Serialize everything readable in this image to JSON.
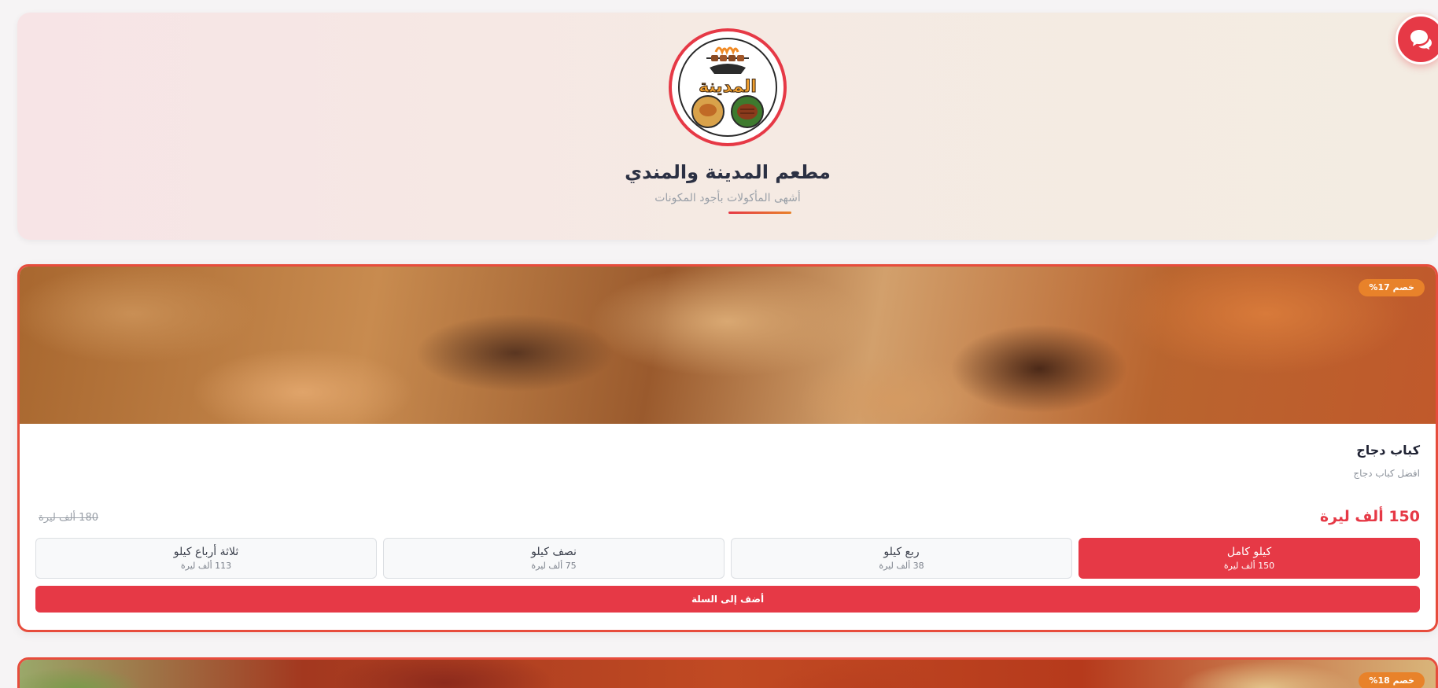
{
  "header": {
    "logo_text": "المدينة",
    "title": "مطعم المدينة والمندي",
    "subtitle": "أشهى المأكولات بأجود المكونات"
  },
  "chat": {
    "icon": "chat-bubbles-icon"
  },
  "products": [
    {
      "discount_badge": "خصم 17%",
      "name": "كباب دجاج",
      "description": "افضل كباب دجاج",
      "price": "150 ألف ليرة",
      "old_price": "180 ألف ليرة",
      "options": [
        {
          "label": "كيلو كامل",
          "price": "150 ألف ليرة",
          "selected": true
        },
        {
          "label": "ربع كيلو",
          "price": "38 ألف ليرة",
          "selected": false
        },
        {
          "label": "نصف كيلو",
          "price": "75 ألف ليرة",
          "selected": false
        },
        {
          "label": "ثلاثة أرباع كيلو",
          "price": "113 ألف ليرة",
          "selected": false
        }
      ],
      "add_to_cart": "أضف إلى السلة"
    },
    {
      "discount_badge": "خصم 18%"
    }
  ],
  "colors": {
    "accent": "#e63946",
    "badge": "#e8822a",
    "card_border": "#e74c3c"
  }
}
